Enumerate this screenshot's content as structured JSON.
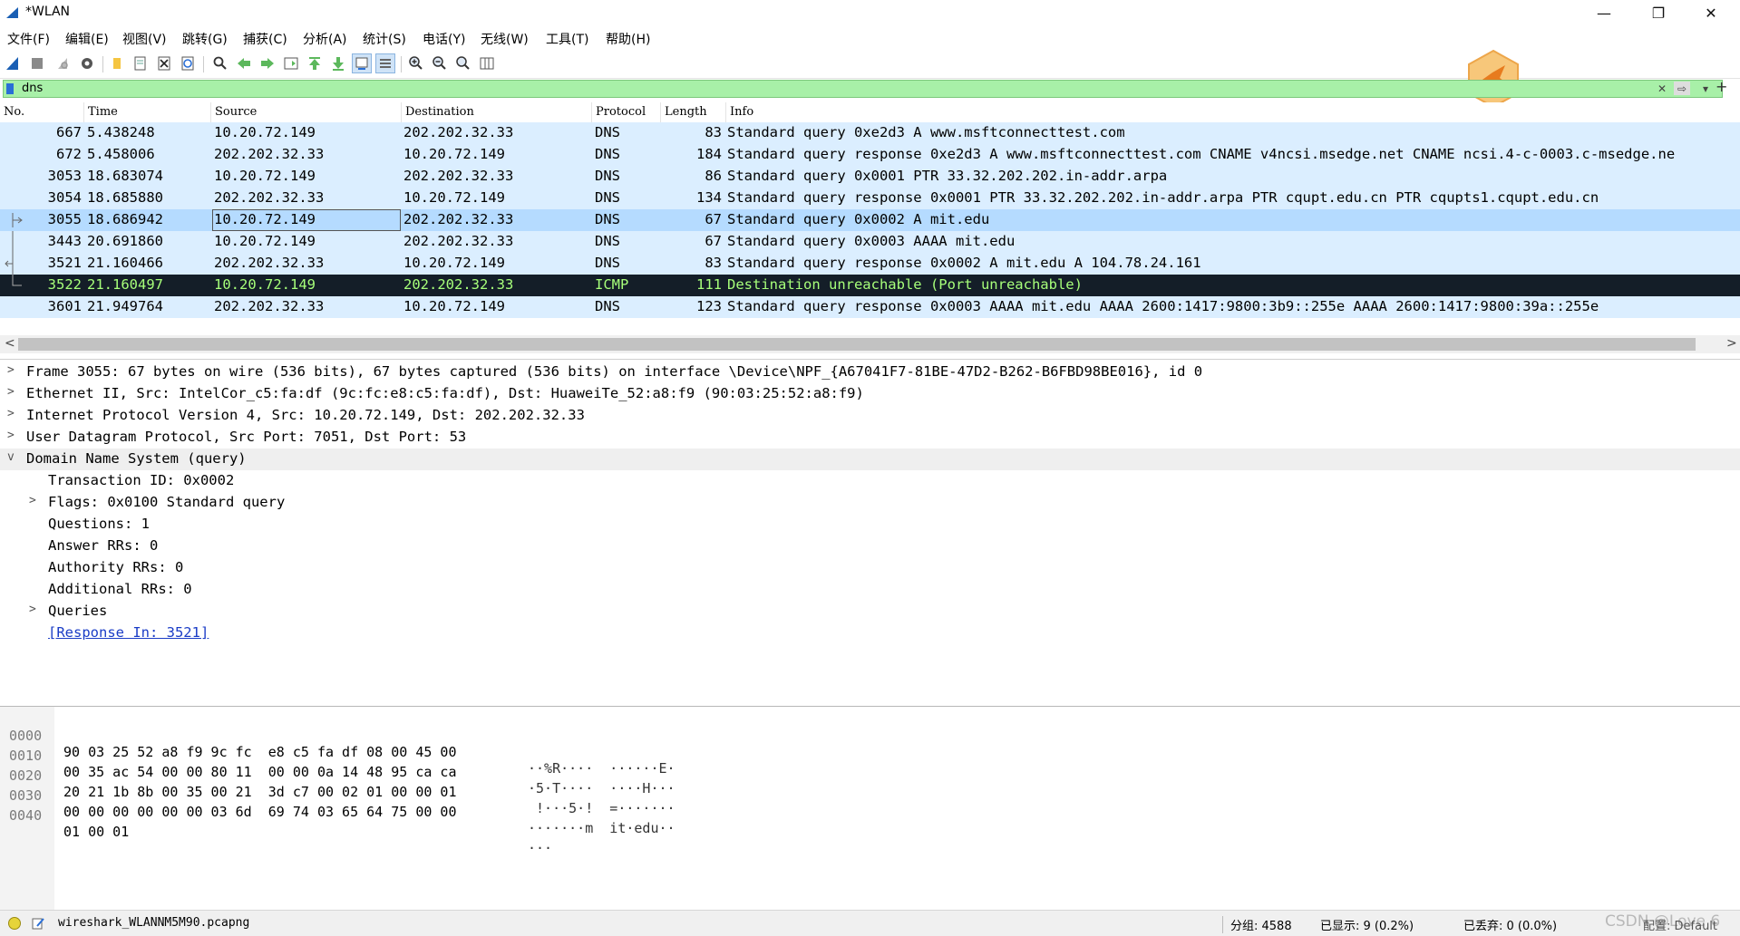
{
  "window": {
    "title": "*WLAN",
    "minimize": "—",
    "restore": "❐",
    "close": "✕"
  },
  "menu": [
    "文件(F)",
    "编辑(E)",
    "视图(V)",
    "跳转(G)",
    "捕获(C)",
    "分析(A)",
    "统计(S)",
    "电话(Y)",
    "无线(W)",
    "工具(T)",
    "帮助(H)"
  ],
  "toolbar": {
    "icons": [
      "shark-fin-start-icon",
      "stop-icon",
      "restart-icon",
      "options-gear-icon",
      "open-folder-icon",
      "save-file-icon",
      "close-file-icon",
      "reload-icon",
      "find-icon",
      "go-back-icon",
      "go-forward-icon",
      "go-to-packet-icon",
      "first-packet-icon",
      "last-packet-icon",
      "autoscroll-icon",
      "colorize-icon",
      "zoom-in-icon",
      "zoom-out-icon",
      "normal-size-icon",
      "resize-columns-icon"
    ]
  },
  "filter": {
    "value": "dns",
    "clear": "✕",
    "apply": "⇨",
    "dropdown": "▾",
    "add": "+"
  },
  "packet_list": {
    "headers": {
      "no": "No.",
      "time": "Time",
      "source": "Source",
      "destination": "Destination",
      "protocol": "Protocol",
      "length": "Length",
      "info": "Info"
    },
    "rows": [
      {
        "no": "667",
        "time": "5.438248",
        "source": "10.20.72.149",
        "destination": "202.202.32.33",
        "protocol": "DNS",
        "length": "83",
        "info": "Standard query 0xe2d3 A www.msftconnecttest.com",
        "style": "normal"
      },
      {
        "no": "672",
        "time": "5.458006",
        "source": "202.202.32.33",
        "destination": "10.20.72.149",
        "protocol": "DNS",
        "length": "184",
        "info": "Standard query response 0xe2d3 A www.msftconnecttest.com CNAME v4ncsi.msedge.net CNAME ncsi.4-c-0003.c-msedge.ne",
        "style": "normal"
      },
      {
        "no": "3053",
        "time": "18.683074",
        "source": "10.20.72.149",
        "destination": "202.202.32.33",
        "protocol": "DNS",
        "length": "86",
        "info": "Standard query 0x0001 PTR 33.32.202.202.in-addr.arpa",
        "style": "normal"
      },
      {
        "no": "3054",
        "time": "18.685880",
        "source": "202.202.32.33",
        "destination": "10.20.72.149",
        "protocol": "DNS",
        "length": "134",
        "info": "Standard query response 0x0001 PTR 33.32.202.202.in-addr.arpa PTR cqupt.edu.cn PTR cqupts1.cqupt.edu.cn",
        "style": "normal"
      },
      {
        "no": "3055",
        "time": "18.686942",
        "source": "10.20.72.149",
        "destination": "202.202.32.33",
        "protocol": "DNS",
        "length": "67",
        "info": "Standard query 0x0002 A mit.edu",
        "style": "selected"
      },
      {
        "no": "3443",
        "time": "20.691860",
        "source": "10.20.72.149",
        "destination": "202.202.32.33",
        "protocol": "DNS",
        "length": "67",
        "info": "Standard query 0x0003 AAAA mit.edu",
        "style": "normal"
      },
      {
        "no": "3521",
        "time": "21.160466",
        "source": "202.202.32.33",
        "destination": "10.20.72.149",
        "protocol": "DNS",
        "length": "83",
        "info": "Standard query response 0x0002 A mit.edu A 104.78.24.161",
        "style": "normal"
      },
      {
        "no": "3522",
        "time": "21.160497",
        "source": "10.20.72.149",
        "destination": "202.202.32.33",
        "protocol": "ICMP",
        "length": "111",
        "info": "Destination unreachable (Port unreachable)",
        "style": "icmp"
      },
      {
        "no": "3601",
        "time": "21.949764",
        "source": "202.202.32.33",
        "destination": "10.20.72.149",
        "protocol": "DNS",
        "length": "123",
        "info": "Standard query response 0x0003 AAAA mit.edu AAAA 2600:1417:9800:3b9::255e AAAA 2600:1417:9800:39a::255e",
        "style": "normal"
      }
    ]
  },
  "scroll": {
    "left": "<",
    "right": ">"
  },
  "details": [
    {
      "level": 0,
      "arrow": ">",
      "text": "Frame 3055: 67 bytes on wire (536 bits), 67 bytes captured (536 bits) on interface \\Device\\NPF_{A67041F7-81BE-47D2-B262-B6FBD98BE016}, id 0"
    },
    {
      "level": 0,
      "arrow": ">",
      "text": "Ethernet II, Src: IntelCor_c5:fa:df (9c:fc:e8:c5:fa:df), Dst: HuaweiTe_52:a8:f9 (90:03:25:52:a8:f9)"
    },
    {
      "level": 0,
      "arrow": ">",
      "text": "Internet Protocol Version 4, Src: 10.20.72.149, Dst: 202.202.32.33"
    },
    {
      "level": 0,
      "arrow": ">",
      "text": "User Datagram Protocol, Src Port: 7051, Dst Port: 53"
    },
    {
      "level": 0,
      "arrow": "v",
      "text": "Domain Name System (query)"
    },
    {
      "level": 1,
      "arrow": "",
      "text": "Transaction ID: 0x0002"
    },
    {
      "level": 1,
      "arrow": ">",
      "text": "Flags: 0x0100 Standard query"
    },
    {
      "level": 1,
      "arrow": "",
      "text": "Questions: 1"
    },
    {
      "level": 1,
      "arrow": "",
      "text": "Answer RRs: 0"
    },
    {
      "level": 1,
      "arrow": "",
      "text": "Authority RRs: 0"
    },
    {
      "level": 1,
      "arrow": "",
      "text": "Additional RRs: 0"
    },
    {
      "level": 1,
      "arrow": ">",
      "text": "Queries"
    },
    {
      "level": 1,
      "arrow": "",
      "text": "[Response In: 3521]",
      "link": true
    }
  ],
  "bytes": [
    {
      "offset": "0000",
      "hex": "90 03 25 52 a8 f9 9c fc  e8 c5 fa df 08 00 45 00",
      "ascii": "··%R····  ······E·"
    },
    {
      "offset": "0010",
      "hex": "00 35 ac 54 00 00 80 11  00 00 0a 14 48 95 ca ca",
      "ascii": "·5·T····  ····H···"
    },
    {
      "offset": "0020",
      "hex": "20 21 1b 8b 00 35 00 21  3d c7 00 02 01 00 00 01",
      "ascii": " !···5·!  =·······"
    },
    {
      "offset": "0030",
      "hex": "00 00 00 00 00 00 03 6d  69 74 03 65 64 75 00 00",
      "ascii": "·······m  it·edu··"
    },
    {
      "offset": "0040",
      "hex": "01 00 01",
      "ascii": "···"
    }
  ],
  "status": {
    "file": "wireshark_WLANNM5M90.pcapng",
    "packets": "分组: 4588",
    "displayed": "已显示: 9 (0.2%)",
    "dropped": "已丢弃: 0 (0.0%)",
    "profile": "配置: Default",
    "watermark": "CSDN @Love 6"
  },
  "colors": {
    "row_bg": "#dbeeff",
    "selected_bg": "#b5dbff",
    "icmp_bg": "#141e28",
    "icmp_fg": "#a7ff7a",
    "filter_bg": "#a8f0a8"
  }
}
